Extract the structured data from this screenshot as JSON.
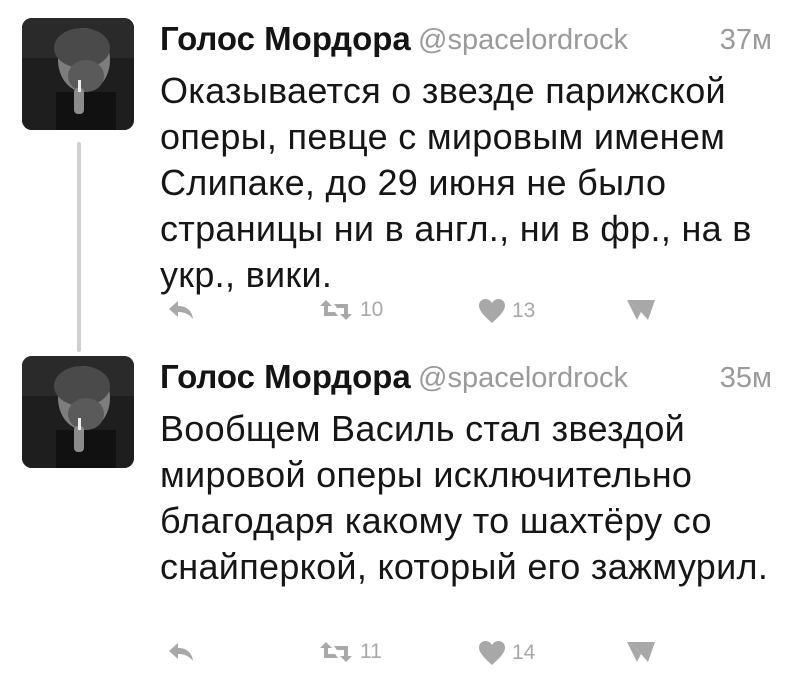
{
  "tweets": [
    {
      "author": "Голос Мордора",
      "handle": "@spacelordrock",
      "time": "37м",
      "text": "Оказывается о звезде парижской оперы, певце с мировым именем Слипаке, до 29 июня не было страницы ни в англ., ни в фр., на в укр., вики.",
      "retweets": "10",
      "likes": "13"
    },
    {
      "author": "Голос Мордора",
      "handle": "@spacelordrock",
      "time": "35м",
      "text": "Вообщем Василь стал звездой мировой оперы исключительно благодаря какому то шахтёру со снайперкой, который его зажмурил.",
      "retweets": "11",
      "likes": "14"
    }
  ],
  "icons": {
    "reply": "reply-arrow-icon",
    "retweet": "retweet-icon",
    "like": "heart-icon",
    "dm": "direct-message-icon"
  },
  "colors": {
    "text": "#161616",
    "muted": "#9a9a9a",
    "icon": "#a8a8a8",
    "thread_line": "#cfcfcf"
  }
}
